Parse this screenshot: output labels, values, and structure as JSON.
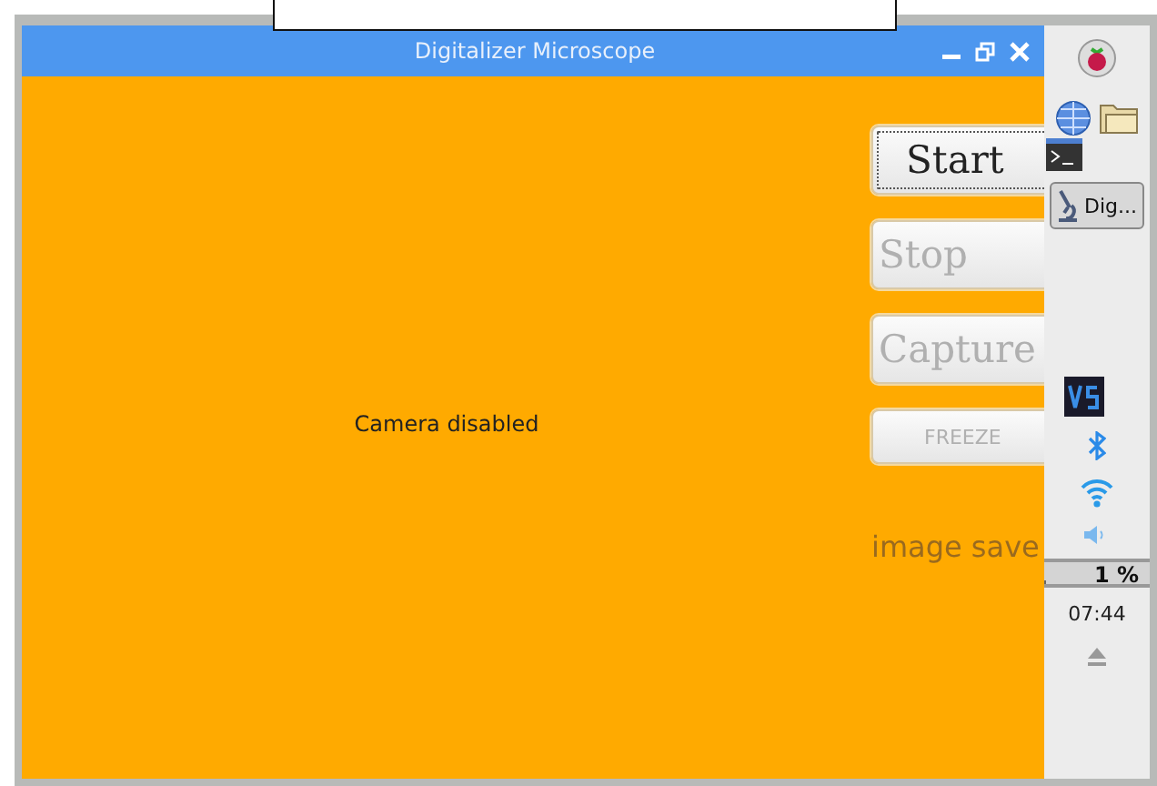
{
  "window": {
    "title": "Digitalizer Microscope"
  },
  "preview": {
    "message": "Camera disabled"
  },
  "buttons": [
    {
      "label": "Start",
      "kind": "large",
      "disabled": false,
      "focused": true
    },
    {
      "label": "Stop",
      "kind": "large",
      "disabled": true,
      "focused": false
    },
    {
      "label": "Capture",
      "kind": "large",
      "disabled": true,
      "focused": false
    },
    {
      "label": "FREEZE",
      "kind": "small",
      "disabled": true,
      "focused": false
    }
  ],
  "status": {
    "text": "image save"
  },
  "panel": {
    "task": {
      "label": "Dig..."
    },
    "cpu": {
      "reading": "1 %",
      "level": 0.01
    },
    "clock": "07:44"
  }
}
